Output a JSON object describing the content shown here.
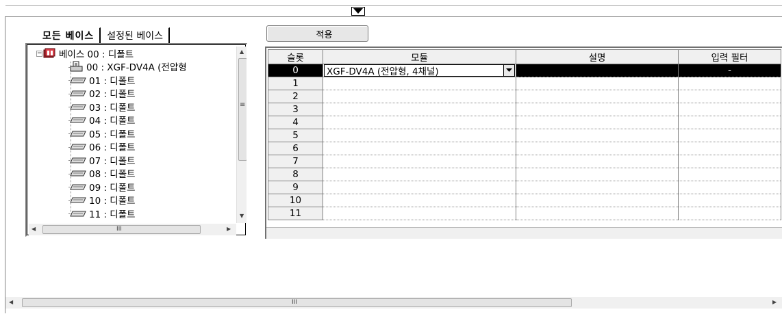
{
  "tabs": {
    "all_bases": "모든 베이스",
    "configured_bases": "설정된 베이스"
  },
  "apply_button": "적용",
  "tree": {
    "root": "베이스 00 : 디폴트",
    "items": [
      "00 : XGF-DV4A (전압형",
      "01 : 디폴트",
      "02 : 디폴트",
      "03 : 디폴트",
      "04 : 디폴트",
      "05 : 디폴트",
      "06 : 디폴트",
      "07 : 디폴트",
      "08 : 디폴트",
      "09 : 디폴트",
      "10 : 디폴트",
      "11 : 디폴트"
    ]
  },
  "grid": {
    "columns": [
      "슬롯",
      "모듈",
      "설명",
      "입력 필터"
    ],
    "rows": [
      {
        "slot": "0",
        "module": "XGF-DV4A (전압형, 4채널)",
        "description": "",
        "filter": "-"
      },
      {
        "slot": "1",
        "module": "",
        "description": "",
        "filter": ""
      },
      {
        "slot": "2",
        "module": "",
        "description": "",
        "filter": ""
      },
      {
        "slot": "3",
        "module": "",
        "description": "",
        "filter": ""
      },
      {
        "slot": "4",
        "module": "",
        "description": "",
        "filter": ""
      },
      {
        "slot": "5",
        "module": "",
        "description": "",
        "filter": ""
      },
      {
        "slot": "6",
        "module": "",
        "description": "",
        "filter": ""
      },
      {
        "slot": "7",
        "module": "",
        "description": "",
        "filter": ""
      },
      {
        "slot": "8",
        "module": "",
        "description": "",
        "filter": ""
      },
      {
        "slot": "9",
        "module": "",
        "description": "",
        "filter": ""
      },
      {
        "slot": "10",
        "module": "",
        "description": "",
        "filter": ""
      },
      {
        "slot": "11",
        "module": "",
        "description": "",
        "filter": ""
      }
    ]
  },
  "icons": {
    "collapse": "triangle-down-icon",
    "root": "base-rack-icon",
    "module_installed": "analog-module-icon",
    "module_empty": "empty-slot-icon",
    "combo_drop": "dropdown-arrow-icon"
  },
  "scroll_grip": "III"
}
